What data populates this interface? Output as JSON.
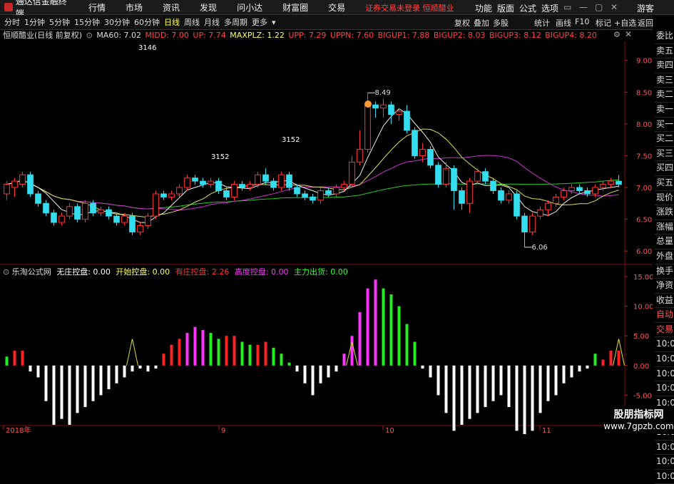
{
  "topbar": {
    "app_title": "通达信金融终端",
    "menu": [
      "行情",
      "市场",
      "资讯",
      "发现",
      "问小达",
      "财富圈",
      "交易"
    ],
    "status": "证券交易未登录  恒顺醋业",
    "right": [
      "功能",
      "版面",
      "公式",
      "选项"
    ],
    "guest": "游客"
  },
  "toolbar": {
    "timeframes": [
      "分时",
      "1分钟",
      "5分钟",
      "15分钟",
      "30分钟",
      "60分钟",
      "日线",
      "周线",
      "月线",
      "多周期",
      "更多"
    ],
    "active_timeframe": "日线",
    "buttons": [
      "复权",
      "叠加",
      "多股",
      "统计",
      "画线",
      "F10",
      "标记",
      "+自选",
      "返回"
    ]
  },
  "legend": {
    "stock": "恒顺醋业(日线 前复权)",
    "items": [
      {
        "text": "MA60: 7.02",
        "color": "#dddddd"
      },
      {
        "text": "MIDD: 7.00",
        "color": "#ff4444"
      },
      {
        "text": "UP: 7.74",
        "color": "#ff4444"
      },
      {
        "text": "MAXPLZ: 1.22",
        "color": "#ffff66"
      },
      {
        "text": "UPP: 7.29",
        "color": "#ff4444"
      },
      {
        "text": "UPPN: 7.60",
        "color": "#ff4444"
      },
      {
        "text": "BIGUP1: 7.88",
        "color": "#ff4444"
      },
      {
        "text": "BIGUP2: 8.03",
        "color": "#ff4444"
      },
      {
        "text": "BIGUP3: 8.12",
        "color": "#ff4444"
      },
      {
        "text": "BIGUP4: 8.20",
        "color": "#ff4444"
      }
    ]
  },
  "indicator_legend": {
    "name": "乐淘公式网",
    "items": [
      {
        "text": "无庄控盘: 0.00",
        "color": "#ffffff"
      },
      {
        "text": "开始控盘: 0.00",
        "color": "#ffff66"
      },
      {
        "text": "有庄控盘: 2.26",
        "color": "#ff3333"
      },
      {
        "text": "高度控盘: 0.00",
        "color": "#ff33ff"
      },
      {
        "text": "主力出货: 0.00",
        "color": "#33ff33"
      }
    ]
  },
  "sidebar": {
    "items": [
      "委比",
      "卖五",
      "卖四",
      "卖三",
      "卖二",
      "卖一",
      "买一",
      "买二",
      "买三",
      "买四",
      "买五",
      "现价",
      "涨跌",
      "涨幅",
      "总量",
      "外盘",
      "换手",
      "净资",
      "收益",
      "自动",
      "交易",
      "10:05",
      "10:05",
      "10:05",
      "10:05",
      "10:05",
      "10:06",
      "10:06",
      "10:06",
      "10:06",
      "10:06"
    ]
  },
  "annotations": {
    "price_labels": [
      "3146",
      "3152",
      "3152"
    ],
    "high_label": "8.49",
    "low_label": "6.06",
    "dates": [
      "2018年",
      "9",
      "10",
      "11"
    ]
  },
  "chart_data": [
    {
      "type": "candlestick",
      "title": "恒顺醋业(日线 前复权)",
      "ylim": [
        5.8,
        9.3
      ],
      "yticks": [
        "9.00",
        "8.50",
        "8.00",
        "7.50",
        "7.00",
        "6.50",
        "6.00"
      ],
      "yvalues": [
        9.0,
        8.5,
        8.0,
        7.5,
        7.0,
        6.5,
        6.0
      ],
      "candles": [
        [
          6.9,
          7.05,
          6.8,
          7.1
        ],
        [
          7.0,
          7.1,
          6.85,
          7.15
        ],
        [
          7.05,
          7.2,
          7.0,
          7.25
        ],
        [
          7.2,
          6.9,
          6.85,
          7.25
        ],
        [
          6.9,
          6.75,
          6.7,
          6.95
        ],
        [
          6.75,
          6.6,
          6.55,
          6.8
        ],
        [
          6.6,
          6.45,
          6.4,
          6.65
        ],
        [
          6.45,
          6.55,
          6.4,
          6.6
        ],
        [
          6.55,
          6.7,
          6.5,
          6.75
        ],
        [
          6.7,
          6.5,
          6.45,
          6.75
        ],
        [
          6.5,
          6.75,
          6.45,
          6.8
        ],
        [
          6.75,
          6.6,
          6.55,
          6.8
        ],
        [
          6.6,
          6.65,
          6.55,
          6.7
        ],
        [
          6.65,
          6.55,
          6.5,
          6.7
        ],
        [
          6.55,
          6.45,
          6.4,
          6.6
        ],
        [
          6.45,
          6.55,
          6.4,
          6.6
        ],
        [
          6.55,
          6.3,
          6.25,
          6.6
        ],
        [
          6.3,
          6.4,
          6.25,
          6.45
        ],
        [
          6.4,
          6.55,
          6.35,
          6.6
        ],
        [
          6.55,
          6.9,
          6.5,
          6.95
        ],
        [
          6.9,
          6.85,
          6.8,
          6.95
        ],
        [
          6.85,
          6.9,
          6.8,
          6.95
        ],
        [
          6.9,
          7.0,
          6.85,
          7.05
        ],
        [
          7.0,
          7.15,
          6.95,
          7.2
        ],
        [
          7.15,
          7.1,
          7.05,
          7.2
        ],
        [
          7.1,
          7.05,
          7.0,
          7.15
        ],
        [
          7.05,
          7.1,
          7.0,
          7.15
        ],
        [
          7.1,
          6.95,
          6.9,
          7.15
        ],
        [
          6.95,
          6.85,
          6.8,
          7.0
        ],
        [
          6.85,
          7.05,
          6.8,
          7.1
        ],
        [
          7.05,
          7.0,
          6.95,
          7.1
        ],
        [
          7.0,
          7.05,
          6.95,
          7.1
        ],
        [
          7.05,
          7.2,
          7.0,
          7.25
        ],
        [
          7.2,
          7.1,
          7.05,
          7.3
        ],
        [
          7.1,
          7.0,
          6.95,
          7.15
        ],
        [
          7.0,
          7.2,
          6.95,
          7.25
        ],
        [
          7.2,
          7.0,
          6.95,
          7.25
        ],
        [
          7.0,
          6.9,
          6.85,
          7.05
        ],
        [
          6.9,
          6.85,
          6.8,
          6.95
        ],
        [
          6.85,
          6.8,
          6.75,
          6.9
        ],
        [
          6.8,
          6.95,
          6.75,
          7.0
        ],
        [
          6.95,
          6.9,
          6.85,
          7.0
        ],
        [
          6.9,
          7.0,
          6.85,
          7.05
        ],
        [
          7.0,
          7.05,
          6.95,
          7.1
        ],
        [
          7.05,
          7.4,
          7.0,
          7.5
        ],
        [
          7.4,
          7.6,
          7.35,
          7.9
        ],
        [
          7.6,
          8.3,
          7.55,
          8.49
        ],
        [
          8.3,
          8.25,
          8.1,
          8.35
        ],
        [
          8.25,
          8.3,
          8.1,
          8.4
        ],
        [
          8.3,
          8.15,
          8.0,
          8.35
        ],
        [
          8.15,
          8.2,
          8.05,
          8.25
        ],
        [
          8.2,
          7.9,
          7.85,
          8.3
        ],
        [
          7.9,
          7.5,
          7.45,
          7.95
        ],
        [
          7.5,
          7.6,
          7.4,
          7.7
        ],
        [
          7.6,
          7.35,
          7.3,
          7.65
        ],
        [
          7.35,
          7.05,
          7.0,
          7.4
        ],
        [
          7.05,
          7.3,
          7.0,
          7.4
        ],
        [
          7.3,
          6.95,
          6.65,
          7.35
        ],
        [
          6.95,
          6.75,
          6.65,
          7.0
        ],
        [
          6.75,
          7.1,
          6.6,
          7.15
        ],
        [
          7.1,
          7.25,
          7.05,
          7.3
        ],
        [
          7.25,
          7.1,
          7.05,
          7.3
        ],
        [
          7.1,
          6.95,
          6.9,
          7.15
        ],
        [
          6.95,
          6.8,
          6.75,
          7.0
        ],
        [
          6.8,
          6.9,
          6.75,
          6.95
        ],
        [
          6.9,
          6.55,
          6.5,
          6.95
        ],
        [
          6.55,
          6.3,
          6.06,
          6.6
        ],
        [
          6.3,
          6.55,
          6.25,
          6.6
        ],
        [
          6.55,
          6.65,
          6.5,
          6.7
        ],
        [
          6.65,
          6.75,
          6.55,
          6.8
        ],
        [
          6.75,
          6.85,
          6.7,
          6.9
        ],
        [
          6.85,
          6.95,
          6.8,
          7.0
        ],
        [
          6.95,
          7.0,
          6.9,
          7.05
        ],
        [
          7.0,
          6.95,
          6.9,
          7.05
        ],
        [
          6.95,
          6.9,
          6.85,
          7.0
        ],
        [
          6.9,
          7.0,
          6.85,
          7.05
        ],
        [
          7.0,
          7.05,
          6.95,
          7.1
        ],
        [
          7.05,
          7.1,
          7.0,
          7.15
        ],
        [
          7.1,
          7.05,
          7.0,
          7.2
        ]
      ]
    },
    {
      "type": "bar",
      "title": "乐淘公式网",
      "ylim": [
        -10,
        15
      ],
      "yticks": [
        "15.00",
        "10.00",
        "5.00",
        "0.00",
        "-5.00"
      ],
      "yvalues": [
        15,
        10,
        5,
        0,
        -5
      ],
      "colors": {
        "w": "#ffffff",
        "r": "#ff2222",
        "m": "#ff33ff",
        "g": "#22ee22"
      },
      "bars": [
        [
          1.5,
          "g"
        ],
        [
          2.5,
          "r"
        ],
        [
          2.5,
          "r"
        ],
        [
          -1,
          "w"
        ],
        [
          -2,
          "w"
        ],
        [
          -6,
          "w"
        ],
        [
          -10,
          "w"
        ],
        [
          -9,
          "w"
        ],
        [
          -10,
          "w"
        ],
        [
          -8,
          "w"
        ],
        [
          -7,
          "w"
        ],
        [
          -6,
          "w"
        ],
        [
          -5,
          "w"
        ],
        [
          -4,
          "w"
        ],
        [
          -3,
          "w"
        ],
        [
          -2,
          "w"
        ],
        [
          -1,
          "w"
        ],
        [
          -0.5,
          "w"
        ],
        [
          -1,
          "w"
        ],
        [
          -0.5,
          "w"
        ],
        [
          2,
          "r"
        ],
        [
          3.5,
          "r"
        ],
        [
          4.5,
          "r"
        ],
        [
          5.5,
          "m"
        ],
        [
          6.5,
          "m"
        ],
        [
          6,
          "m"
        ],
        [
          5.5,
          "g"
        ],
        [
          4.5,
          "g"
        ],
        [
          5,
          "r"
        ],
        [
          5,
          "r"
        ],
        [
          4,
          "g"
        ],
        [
          3.5,
          "g"
        ],
        [
          3.5,
          "r"
        ],
        [
          4,
          "r"
        ],
        [
          3,
          "g"
        ],
        [
          2,
          "g"
        ],
        [
          0.5,
          "g"
        ],
        [
          -1,
          "w"
        ],
        [
          -3,
          "w"
        ],
        [
          -5,
          "w"
        ],
        [
          -3,
          "w"
        ],
        [
          -2,
          "w"
        ],
        [
          -1,
          "w"
        ],
        [
          2,
          "m"
        ],
        [
          5,
          "m"
        ],
        [
          9,
          "m"
        ],
        [
          13,
          "m"
        ],
        [
          14.5,
          "m"
        ],
        [
          13,
          "g"
        ],
        [
          12,
          "g"
        ],
        [
          10,
          "g"
        ],
        [
          7,
          "g"
        ],
        [
          4,
          "g"
        ],
        [
          -0.5,
          "w"
        ],
        [
          -2,
          "w"
        ],
        [
          -5,
          "w"
        ],
        [
          -8,
          "w"
        ],
        [
          -11,
          "w"
        ],
        [
          -10,
          "w"
        ],
        [
          -9,
          "w"
        ],
        [
          -8,
          "w"
        ],
        [
          -7,
          "w"
        ],
        [
          -6,
          "w"
        ],
        [
          -5,
          "w"
        ],
        [
          -7,
          "w"
        ],
        [
          -11,
          "w"
        ],
        [
          -12,
          "w"
        ],
        [
          -11,
          "w"
        ],
        [
          -8,
          "w"
        ],
        [
          -6,
          "w"
        ],
        [
          -5,
          "w"
        ],
        [
          -3,
          "w"
        ],
        [
          -2,
          "w"
        ],
        [
          -1,
          "w"
        ],
        [
          -0.5,
          "w"
        ],
        [
          2,
          "g"
        ],
        [
          1,
          "r"
        ],
        [
          2.5,
          "r"
        ],
        [
          2.5,
          "r"
        ]
      ]
    }
  ]
}
